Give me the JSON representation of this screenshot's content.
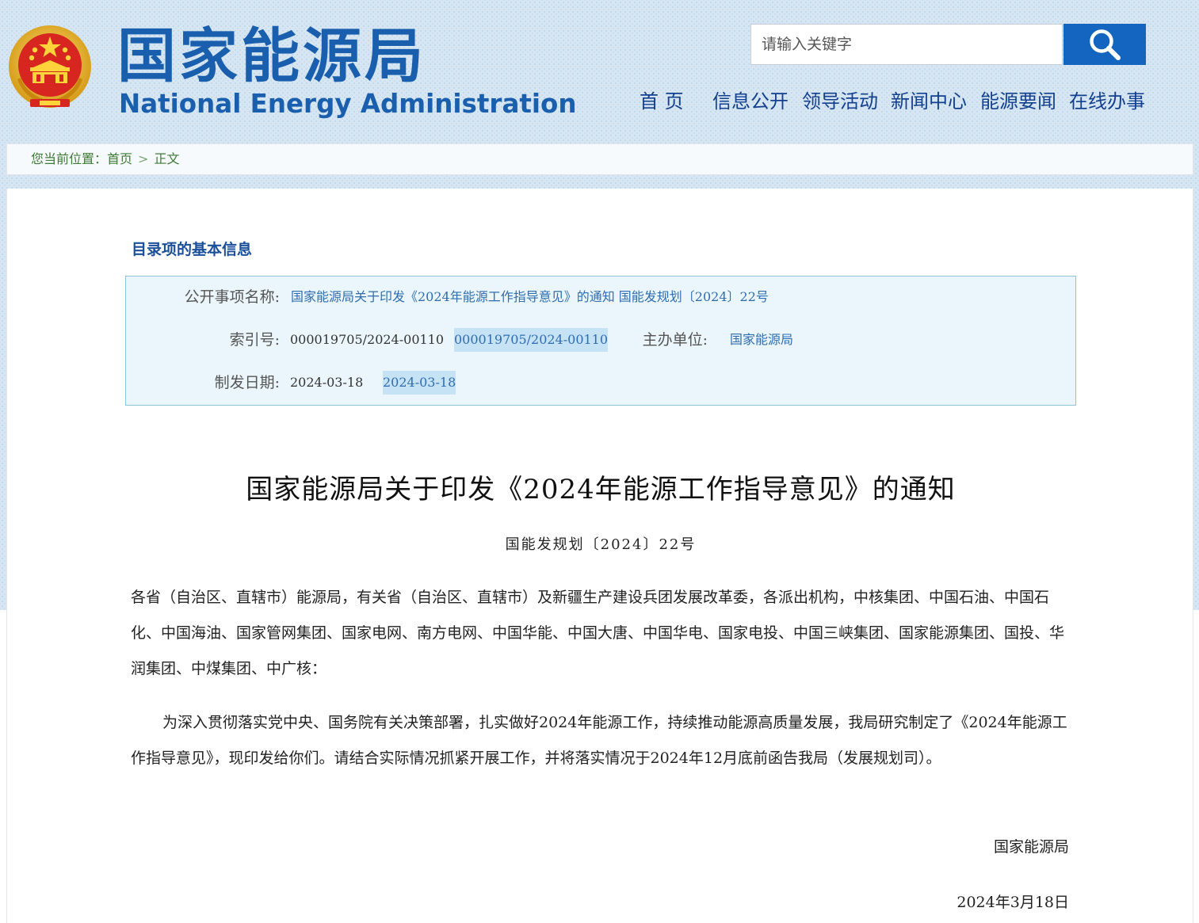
{
  "header": {
    "brand_cn": "国家能源局",
    "brand_en": "National Energy Administration",
    "search_placeholder": "请输入关键字",
    "nav": [
      "首 页",
      "信息公开",
      "领导活动",
      "新闻中心",
      "能源要闻",
      "在线办事"
    ]
  },
  "breadcrumb": {
    "prefix": "您当前位置：",
    "home": "首页",
    "separator": ">",
    "current": "正文"
  },
  "meta": {
    "heading": "目录项的基本信息",
    "name_label": "公开事项名称:",
    "name_value": "国家能源局关于印发《2024年能源工作指导意见》的通知  国能发规划〔2024〕22号",
    "index_label": "索引号:",
    "index_value": "000019705/2024-00110",
    "index_value_dup": "000019705/2024-00110",
    "dept_label": "主办单位:",
    "dept_value": "国家能源局",
    "date_label": "制发日期:",
    "date_value": "2024-03-18",
    "date_value_dup": "2024-03-18"
  },
  "document": {
    "title": "国家能源局关于印发《2024年能源工作指导意见》的通知",
    "number": "国能发规划〔2024〕22号",
    "recipients": "各省（自治区、直辖市）能源局，有关省（自治区、直辖市）及新疆生产建设兵团发展改革委，各派出机构，中核集团、中国石油、中国石化、中国海油、国家管网集团、国家电网、南方电网、中国华能、中国大唐、中国华电、国家电投、中国三峡集团、国家能源集团、国投、华润集团、中煤集团、中广核：",
    "body": "为深入贯彻落实党中央、国务院有关决策部署，扎实做好2024年能源工作，持续推动能源高质量发展，我局研究制定了《2024年能源工作指导意见》，现印发给你们。请结合实际情况抓紧开展工作，并将落实情况于2024年12月底前函告我局（发展规划司）。",
    "signer": "国家能源局",
    "sign_date": "2024年3月18日"
  },
  "colors": {
    "brand": "#1a5fae",
    "nav": "#13408e",
    "search_button": "#1465c0",
    "breadcrumb_text": "#3d7a35",
    "meta_box_bg": "#eaf6fb"
  },
  "icons": {
    "emblem": "national-emblem-icon",
    "search": "search-icon"
  }
}
